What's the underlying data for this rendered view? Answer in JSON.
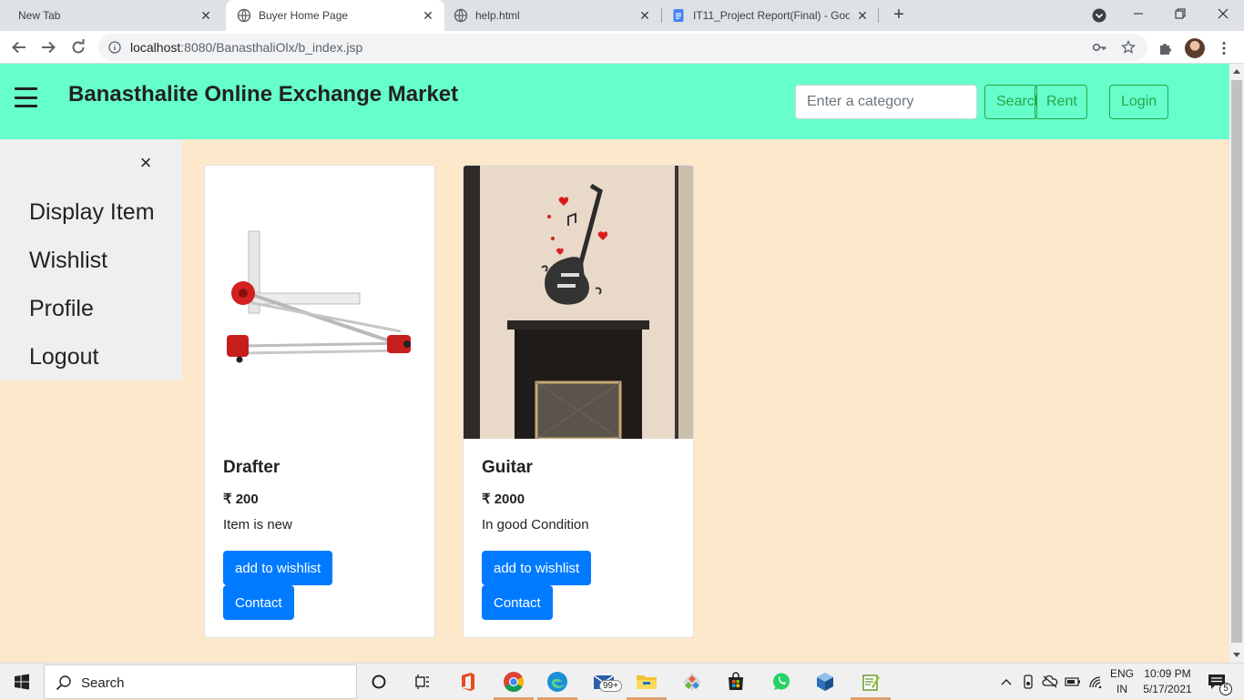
{
  "browser": {
    "tabs": [
      {
        "title": "New Tab",
        "active": false
      },
      {
        "title": "Buyer Home Page",
        "active": true
      },
      {
        "title": "help.html",
        "active": false
      },
      {
        "title": "IT11_Project Report(Final) - Goog",
        "active": false
      }
    ],
    "url_host": "localhost",
    "url_path": ":8080/BanasthaliOlx/b_index.jsp",
    "icons": [
      "back-arrow",
      "forward-arrow",
      "reload",
      "info",
      "key",
      "star",
      "puzzle-extensions",
      "profile-avatar",
      "kebab-menu"
    ]
  },
  "site": {
    "title": "Banasthalite Online Exchange Market",
    "search_placeholder": "Enter a category",
    "search_label": "Search",
    "rent_label": "Rent",
    "login_label": "Login",
    "accent_color": "#66ffcc",
    "button_color": "#007bff",
    "outline_color": "#28a745",
    "background_color": "#fde8cc"
  },
  "sidebar": {
    "close_symbol": "×",
    "items": [
      {
        "label": "Display Item"
      },
      {
        "label": "Wishlist"
      },
      {
        "label": "Profile"
      },
      {
        "label": "Logout"
      }
    ]
  },
  "products": [
    {
      "name": "Drafter",
      "price": "₹ 200",
      "description": "Item is new",
      "wishlist_label": "add to wishlist",
      "contact_label": "Contact",
      "image": "drafter-image"
    },
    {
      "name": "Guitar",
      "price": "₹ 2000",
      "description": "In good Condition",
      "wishlist_label": "add to wishlist",
      "contact_label": "Contact",
      "image": "guitar-wall-sticker-image"
    }
  ],
  "taskbar": {
    "search_label": "Search",
    "mail_badge": "99+",
    "lang_line1": "ENG",
    "lang_line2": "IN",
    "time": "10:09 PM",
    "date": "5/17/2021",
    "notification_count": "5"
  }
}
